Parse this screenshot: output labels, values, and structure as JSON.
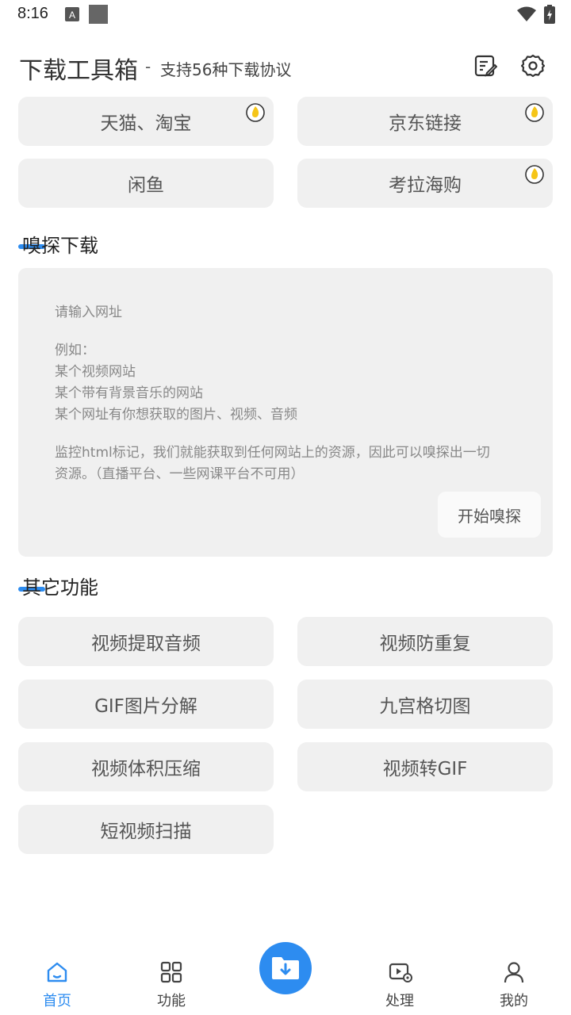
{
  "status_bar": {
    "time": "8:16"
  },
  "header": {
    "title": "下载工具箱",
    "dash": "-",
    "subtitle": "支持56种下载协议",
    "icons": [
      "edit-note-icon",
      "settings-icon"
    ]
  },
  "top_buttons": [
    {
      "label": "天猫、淘宝",
      "hot": true
    },
    {
      "label": "京东链接",
      "hot": true
    },
    {
      "label": "闲鱼",
      "hot": false
    },
    {
      "label": "考拉海购",
      "hot": true
    }
  ],
  "sniff_section": {
    "title": "嗅探下载",
    "placeholder": "请输入网址",
    "example_heading": "例如：",
    "examples": [
      "某个视频网站",
      "某个带有背景音乐的网站",
      "某个网址有你想获取的图片、视频、音频"
    ],
    "note_line1": "监控html标记，我们就能获取到任何网站上的资源，因此可以嗅探出一切",
    "note_line2": "资源。（直播平台、一些网课平台不可用）",
    "start_button": "开始嗅探"
  },
  "other_section": {
    "title": "其它功能",
    "buttons": [
      "视频提取音频",
      "视频防重复",
      "GIF图片分解",
      "九宫格切图",
      "视频体积压缩",
      "视频转GIF",
      "短视频扫描"
    ]
  },
  "bottom_nav": {
    "items": [
      {
        "label": "首页",
        "icon": "home-icon",
        "active": true
      },
      {
        "label": "功能",
        "icon": "grid-icon",
        "active": false
      },
      {
        "label": "处理",
        "icon": "video-process-icon",
        "active": false
      },
      {
        "label": "我的",
        "icon": "profile-icon",
        "active": false
      }
    ],
    "fab_icon": "download-folder-icon"
  },
  "colors": {
    "accent": "#2d8cf0",
    "button_bg": "#f0f0f0",
    "hot_badge": "#f5c518"
  }
}
